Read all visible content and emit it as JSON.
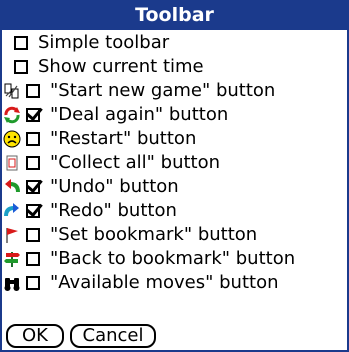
{
  "dialog": {
    "title": "Toolbar",
    "options": [
      {
        "label": "Simple toolbar",
        "checked": false,
        "icon": null
      },
      {
        "label": "Show current time",
        "checked": false,
        "icon": null
      },
      {
        "label": "\"Start new game\" button",
        "checked": false,
        "icon": "cards-shuffle-icon"
      },
      {
        "label": "\"Deal again\" button",
        "checked": true,
        "icon": "deal-again-icon"
      },
      {
        "label": "\"Restart\" button",
        "checked": false,
        "icon": "sad-face-icon"
      },
      {
        "label": "\"Collect all\" button",
        "checked": false,
        "icon": "collect-card-icon"
      },
      {
        "label": "\"Undo\" button",
        "checked": true,
        "icon": "undo-arrow-icon"
      },
      {
        "label": "\"Redo\" button",
        "checked": true,
        "icon": "redo-arrow-icon"
      },
      {
        "label": "\"Set bookmark\" button",
        "checked": false,
        "icon": "flag-icon"
      },
      {
        "label": "\"Back to bookmark\" button",
        "checked": false,
        "icon": "signpost-icon"
      },
      {
        "label": "\"Available moves\" button",
        "checked": false,
        "icon": "binoculars-icon"
      }
    ],
    "ok_label": "OK",
    "cancel_label": "Cancel"
  }
}
